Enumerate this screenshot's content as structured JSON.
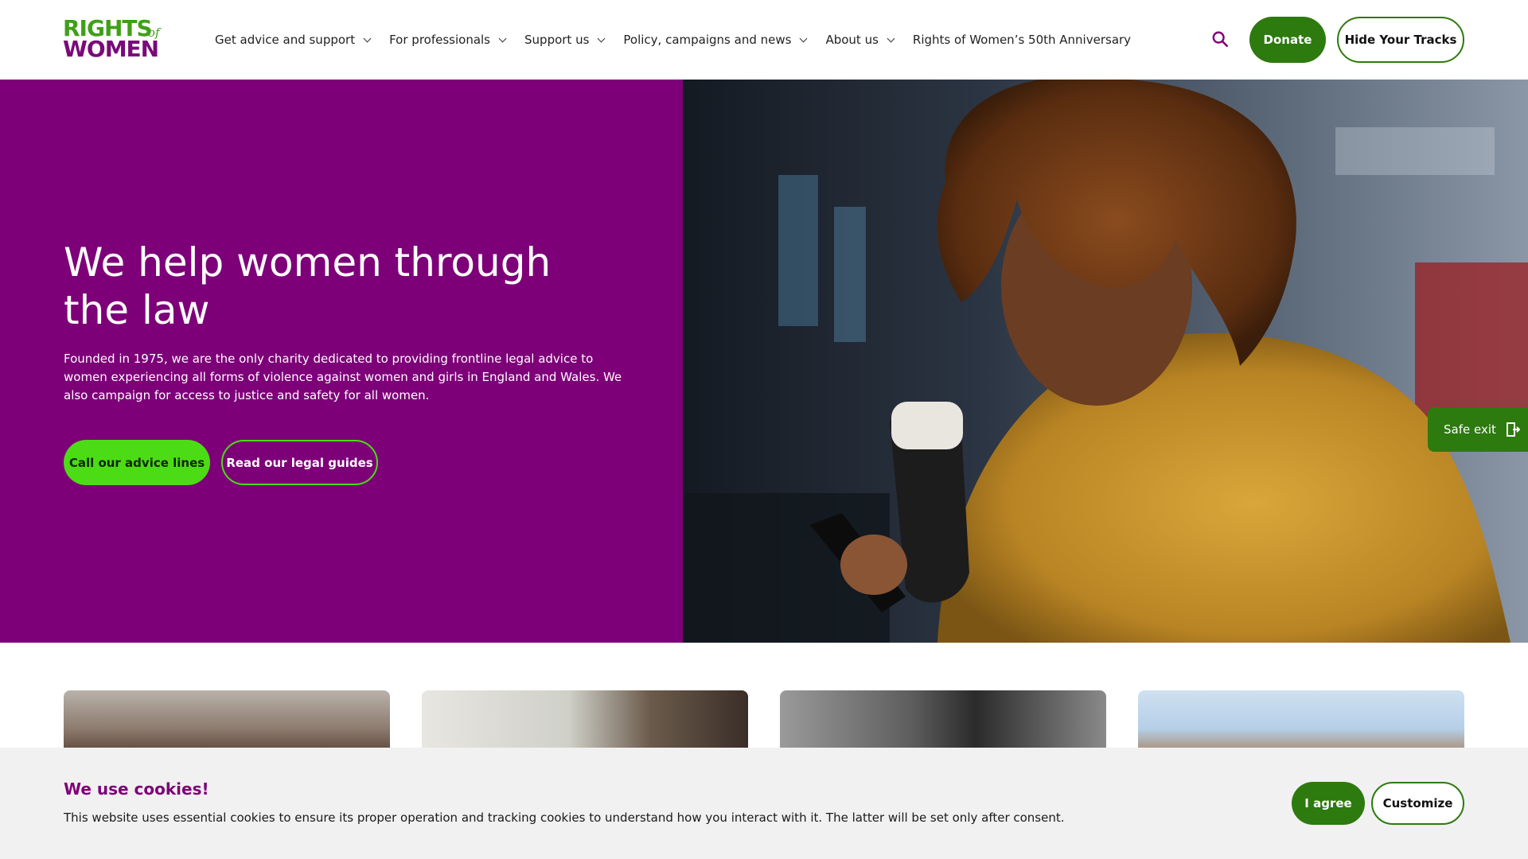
{
  "header": {
    "logo": {
      "line1": "RIGHTS",
      "of": "of",
      "line2": "WOMEN"
    },
    "nav": [
      {
        "label": "Get advice and support",
        "has_dropdown": true
      },
      {
        "label": "For professionals",
        "has_dropdown": true
      },
      {
        "label": "Support us",
        "has_dropdown": true
      },
      {
        "label": "Policy, campaigns and news",
        "has_dropdown": true
      },
      {
        "label": "About us",
        "has_dropdown": true
      },
      {
        "label": "Rights of Women’s 50th Anniversary",
        "has_dropdown": false
      }
    ],
    "search_icon": "search-icon",
    "donate_label": "Donate",
    "hide_tracks_label": "Hide Your Tracks"
  },
  "hero": {
    "title": "We help women through the law",
    "text": "Founded in 1975, we are the only charity dedicated to providing frontline legal advice to women experiencing all forms of violence against women and girls in England and Wales. We also campaign for access to justice and safety for all women.",
    "primary_button": "Call our advice lines",
    "secondary_button": "Read our legal guides"
  },
  "safe_exit": {
    "label": "Safe exit",
    "icon": "exit-door-icon"
  },
  "cookie_banner": {
    "title": "We use cookies!",
    "text": "This website uses essential cookies to ensure its proper operation and tracking cookies to understand how you interact with it. The latter will be set only after consent.",
    "agree_label": "I agree",
    "customize_label": "Customize"
  },
  "colors": {
    "brand_purple": "#7d0078",
    "brand_green": "#2d7a0e",
    "accent_green": "#4cdc16",
    "logo_green": "#3fa018"
  }
}
